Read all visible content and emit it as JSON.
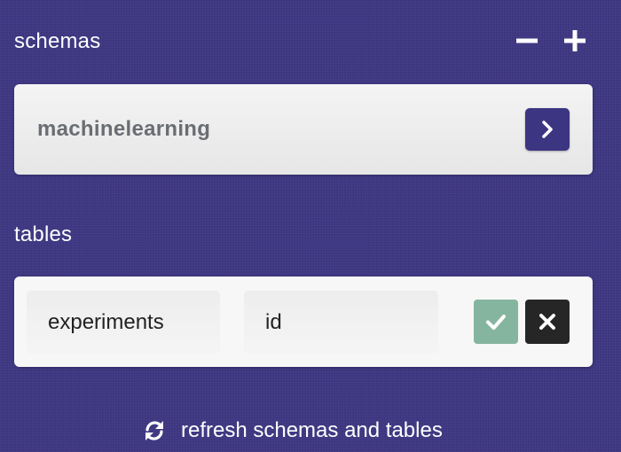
{
  "schemas": {
    "title": "schemas",
    "remove_icon": "minus-icon",
    "add_icon": "plus-icon",
    "items": [
      {
        "name": "machinelearning",
        "action_icon": "chevron-right-icon"
      }
    ]
  },
  "tables": {
    "title": "tables",
    "new_row": {
      "table_name": "experiments",
      "key_column": "id",
      "confirm_icon": "check-icon",
      "cancel_icon": "close-icon"
    }
  },
  "refresh": {
    "label": "refresh schemas and tables",
    "icon": "refresh-icon"
  },
  "colors": {
    "background": "#3d3680",
    "accent": "#3c3582",
    "confirm": "#86b59f",
    "cancel": "#262626",
    "schema_text": "#6a6e72"
  }
}
